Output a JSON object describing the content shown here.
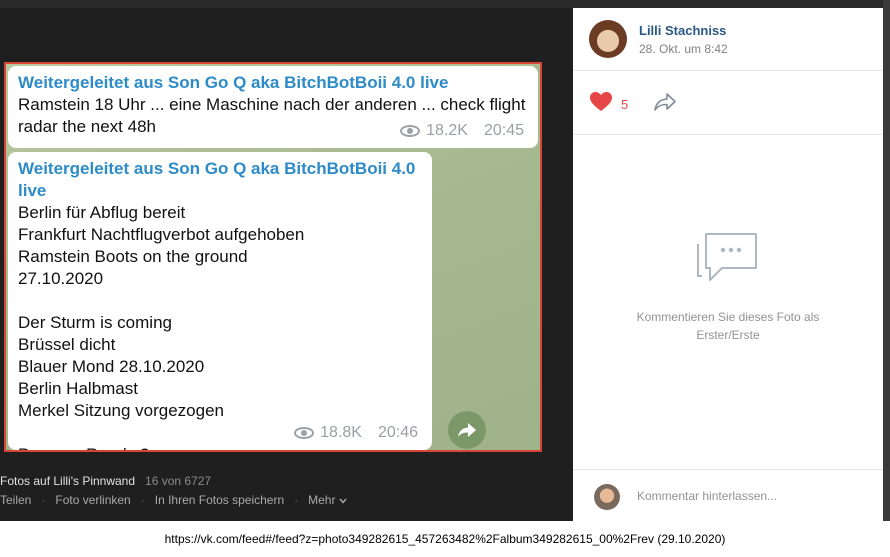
{
  "chat": {
    "message1": {
      "forward_header": "Weitergeleitet aus Son Go Q aka BitchBotBoii 4.0 live",
      "lines": [
        "Ramstein 18 Uhr ... eine Maschine nach der anderen ... check flight",
        "radar the next 48h"
      ],
      "views": "18.2K",
      "time": "20:45"
    },
    "message2": {
      "forward_header": "Weitergeleitet aus Son Go Q aka BitchBotBoii 4.0 live",
      "lines": [
        "Berlin für Abflug bereit",
        "Frankfurt Nachtflugverbot aufgehoben",
        "Ramstein Boots on the ground",
        "27.10.2020",
        "",
        "Der Sturm is coming",
        "Brüssel dicht",
        "Blauer Mond 28.10.2020",
        "Berlin Halbmast",
        "Merkel Sitzung vorgezogen",
        "",
        "Popcorn Ready ?"
      ],
      "views": "18.8K",
      "time": "20:46"
    }
  },
  "viewer": {
    "album_label": "Fotos auf Lilli's Pinnwand",
    "counter": "16 von 6727",
    "actions": [
      "Teilen",
      "Foto verlinken",
      "In Ihren Fotos speichern",
      "Mehr"
    ]
  },
  "panel": {
    "author": "Lilli Stachniss",
    "date": "28. Okt. um 8:42",
    "like_count": "5",
    "empty_comments": "Kommentieren Sie dieses Foto als Erster/Erste",
    "comment_placeholder": "Kommentar hinterlassen..."
  },
  "source_caption": "https://vk.com/feed#/feed?z=photo349282615_457263482%2Falbum349282615_00%2Frev (29.10.2020)",
  "colors": {
    "backdrop": "#1f1f1f",
    "photo_border": "#d64535",
    "forward_link": "#2d8bc8",
    "author_link": "#2a5885",
    "like_heart": "#e64646"
  }
}
